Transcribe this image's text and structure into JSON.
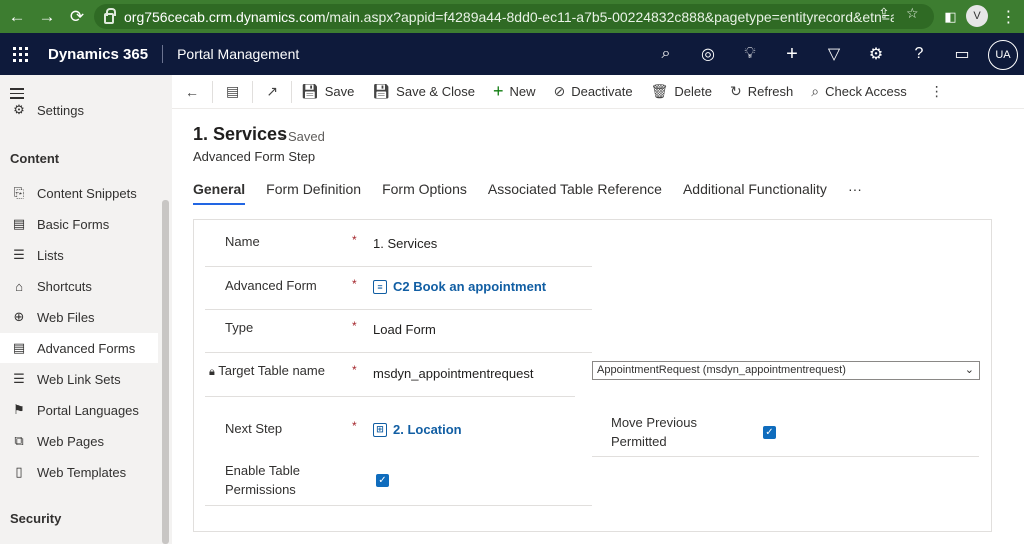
{
  "browser": {
    "url_host": "org756cecab.crm.dynamics.com",
    "url_rest": "/main.aspx?appid=f4289a44-8dd0-ec11-a7b5-00224832c888&pagetype=entityrecord&etn=adx_webf...",
    "profile_initial": "V"
  },
  "app": {
    "name": "Dynamics 365",
    "area": "Portal Management",
    "user_initials": "UA"
  },
  "sidebar": {
    "partial_item": "Settings",
    "section_content": "Content",
    "items": [
      {
        "label": "Content Snippets"
      },
      {
        "label": "Basic Forms"
      },
      {
        "label": "Lists"
      },
      {
        "label": "Shortcuts"
      },
      {
        "label": "Web Files"
      },
      {
        "label": "Advanced Forms"
      },
      {
        "label": "Web Link Sets"
      },
      {
        "label": "Portal Languages"
      },
      {
        "label": "Web Pages"
      },
      {
        "label": "Web Templates"
      }
    ],
    "section_security": "Security"
  },
  "commandbar": {
    "save": "Save",
    "save_close": "Save & Close",
    "new": "New",
    "deactivate": "Deactivate",
    "delete": "Delete",
    "refresh": "Refresh",
    "check_access": "Check Access"
  },
  "record": {
    "title": "1. Services",
    "status": "- Saved",
    "entity": "Advanced Form Step"
  },
  "tabs": [
    "General",
    "Form Definition",
    "Form Options",
    "Associated Table Reference",
    "Additional Functionality",
    "···"
  ],
  "form": {
    "name_label": "Name",
    "name_value": "1. Services",
    "advanced_form_label": "Advanced Form",
    "advanced_form_value": "C2 Book an appointment",
    "type_label": "Type",
    "type_value": "Load Form",
    "target_table_label": "Target Table name",
    "target_table_value": "msdyn_appointmentrequest",
    "target_table_select": "AppointmentRequest (msdyn_appointmentrequest)",
    "next_step_label": "Next Step",
    "next_step_value": "2. Location",
    "enable_permissions_label_1": "Enable Table",
    "enable_permissions_label_2": "Permissions",
    "move_previous_label_1": "Move Previous",
    "move_previous_label_2": "Permitted",
    "required_mark": "*",
    "enable_permissions_checked": true,
    "move_previous_checked": true
  },
  "colors": {
    "browser_bar": "#3d7d30",
    "app_bar": "#0e1a3b",
    "link": "#115ea3",
    "accent": "#2266e3",
    "required": "#a4262c"
  }
}
